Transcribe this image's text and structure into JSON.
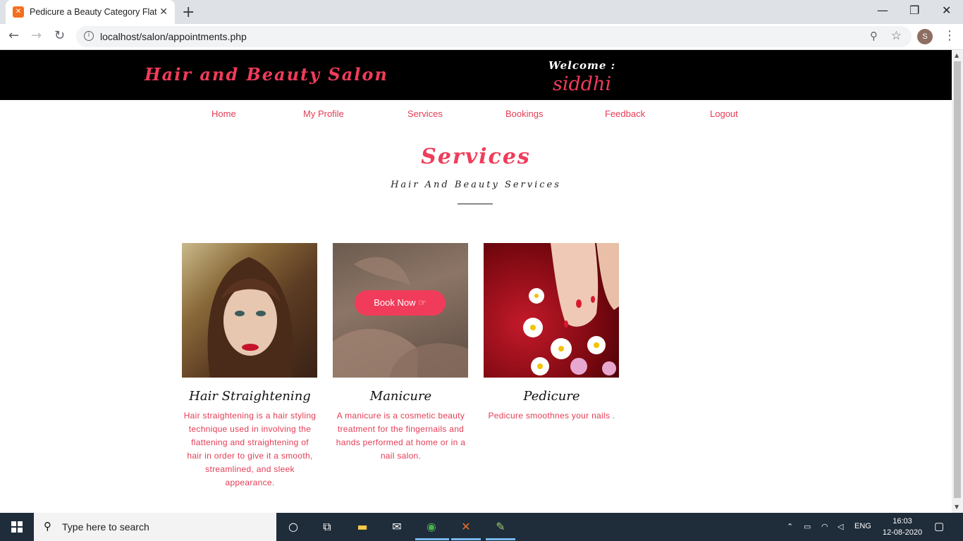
{
  "browser": {
    "tab_title": "Pedicure a Beauty Category Flat B",
    "tab_close": "✕",
    "new_tab": "+",
    "url": "localhost/salon/appointments.php",
    "profile_initial": "S"
  },
  "header": {
    "brand": "Hair and Beauty Salon",
    "welcome_label": "Welcome :",
    "username": "siddhi"
  },
  "nav": {
    "items": [
      "Home",
      "My Profile",
      "Services",
      "Bookings",
      "Feedback",
      "Logout"
    ]
  },
  "section": {
    "title": "Services",
    "subtitle": "Hair And Beauty Services"
  },
  "services": [
    {
      "name": "Hair Straightening",
      "description": "Hair straightening is a hair styling technique used in involving the flattening and straightening of hair in order to give it a smooth, streamlined, and sleek appearance."
    },
    {
      "name": "Manicure",
      "description": "A manicure is a cosmetic beauty treatment for the fingernails and hands performed at home or in a nail salon."
    },
    {
      "name": "Pedicure",
      "description": "Pedicure smoothnes your nails ."
    }
  ],
  "book_now_label": "Book Now ☞",
  "taskbar": {
    "search_placeholder": "Type here to search",
    "language": "ENG",
    "time": "16:03",
    "date": "12-08-2020"
  }
}
